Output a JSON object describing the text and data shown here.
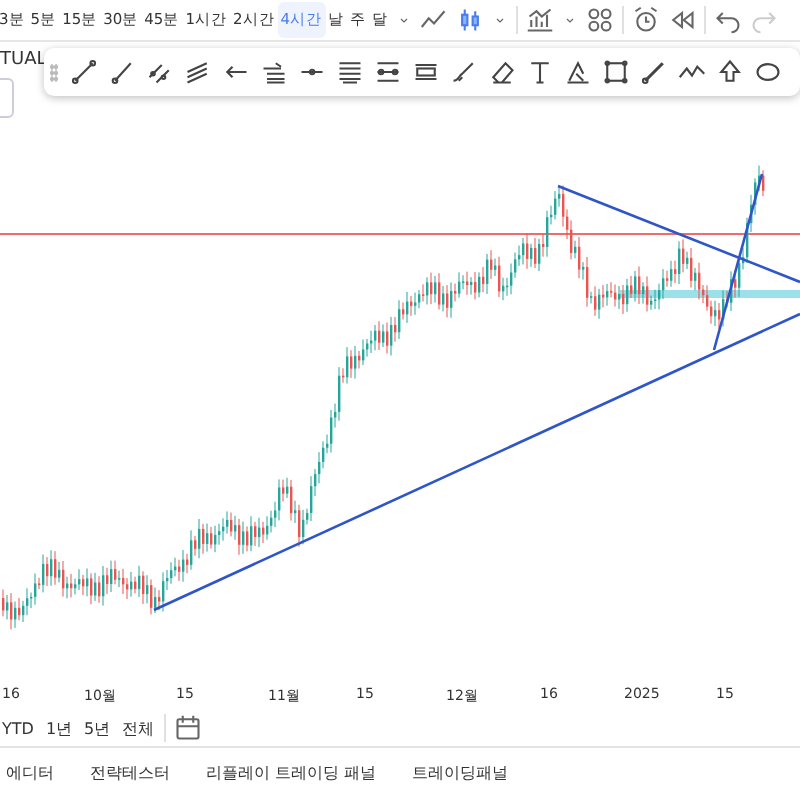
{
  "toolbar": {
    "timeframes": [
      {
        "label": "3분",
        "selected": false
      },
      {
        "label": "5분",
        "selected": false
      },
      {
        "label": "15분",
        "selected": false
      },
      {
        "label": "30분",
        "selected": false
      },
      {
        "label": "45분",
        "selected": false
      },
      {
        "label": "1시간",
        "selected": false
      },
      {
        "label": "2시간",
        "selected": false
      },
      {
        "label": "4시간",
        "selected": true
      },
      {
        "label": "날",
        "selected": false
      },
      {
        "label": "주",
        "selected": false
      },
      {
        "label": "달",
        "selected": false
      }
    ]
  },
  "symbol_label": "TUAL",
  "time_axis": {
    "labels": [
      "16",
      "10월",
      "15",
      "11월",
      "15",
      "12월",
      "16",
      "2025",
      "15"
    ]
  },
  "range_buttons": [
    "YTD",
    "1년",
    "5년",
    "전체"
  ],
  "bottom_tabs": [
    "에디터",
    "전략테스터",
    "리플레이 트레이딩 패널",
    "트레이딩패널"
  ]
}
